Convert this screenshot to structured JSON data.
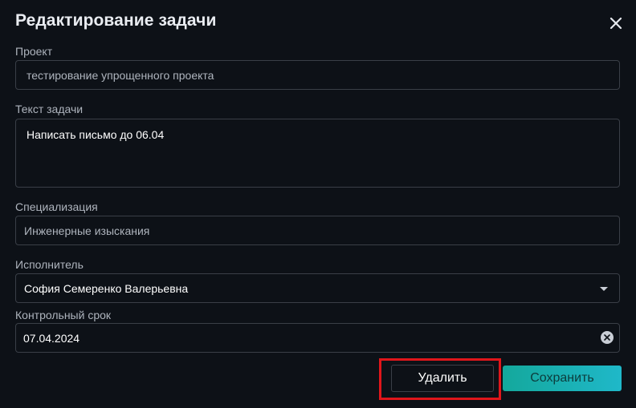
{
  "dialog": {
    "title": "Редактирование задачи"
  },
  "project": {
    "label": "Проект",
    "value": "тестирование упрощенного проекта"
  },
  "task_text": {
    "label": "Текст задачи",
    "value": "Написать письмо до 06.04"
  },
  "specialization": {
    "label": "Специализация",
    "value": "Инженерные изыскания"
  },
  "assignee": {
    "label": "Исполнитель",
    "value": "София Семеренко Валерьевна"
  },
  "deadline": {
    "label": "Контрольный срок",
    "value": "07.04.2024"
  },
  "actions": {
    "delete_label": "Удалить",
    "save_label": "Сохранить"
  },
  "colors": {
    "background": "#0d1117",
    "accent": "#1fb8c9",
    "highlight": "#e0161b"
  },
  "icons": {
    "close": "close-icon",
    "dropdown": "chevron-down-icon",
    "clear": "clear-icon"
  }
}
